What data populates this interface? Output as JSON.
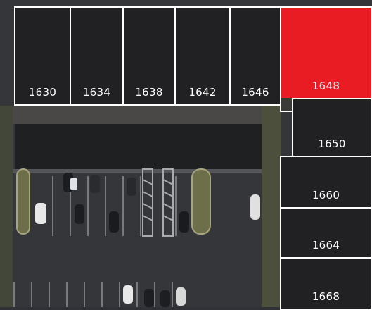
{
  "units": [
    {
      "id": "1630",
      "label": "1630",
      "highlighted": false
    },
    {
      "id": "1634",
      "label": "1634",
      "highlighted": false
    },
    {
      "id": "1638",
      "label": "1638",
      "highlighted": false
    },
    {
      "id": "1642",
      "label": "1642",
      "highlighted": false
    },
    {
      "id": "1646",
      "label": "1646",
      "highlighted": false
    },
    {
      "id": "1648",
      "label": "1648",
      "highlighted": true
    },
    {
      "id": "1650",
      "label": "1650",
      "highlighted": false
    },
    {
      "id": "1660",
      "label": "1660",
      "highlighted": false
    },
    {
      "id": "1664",
      "label": "1664",
      "highlighted": false
    },
    {
      "id": "1668",
      "label": "1668",
      "highlighted": false
    }
  ],
  "colors": {
    "unit_fill": "#212022",
    "unit_border": "#ffffff",
    "highlight_fill": "#e91c23",
    "label_text": "#ffffff"
  },
  "background": {
    "icon": "aerial-photo-parking-lot"
  }
}
